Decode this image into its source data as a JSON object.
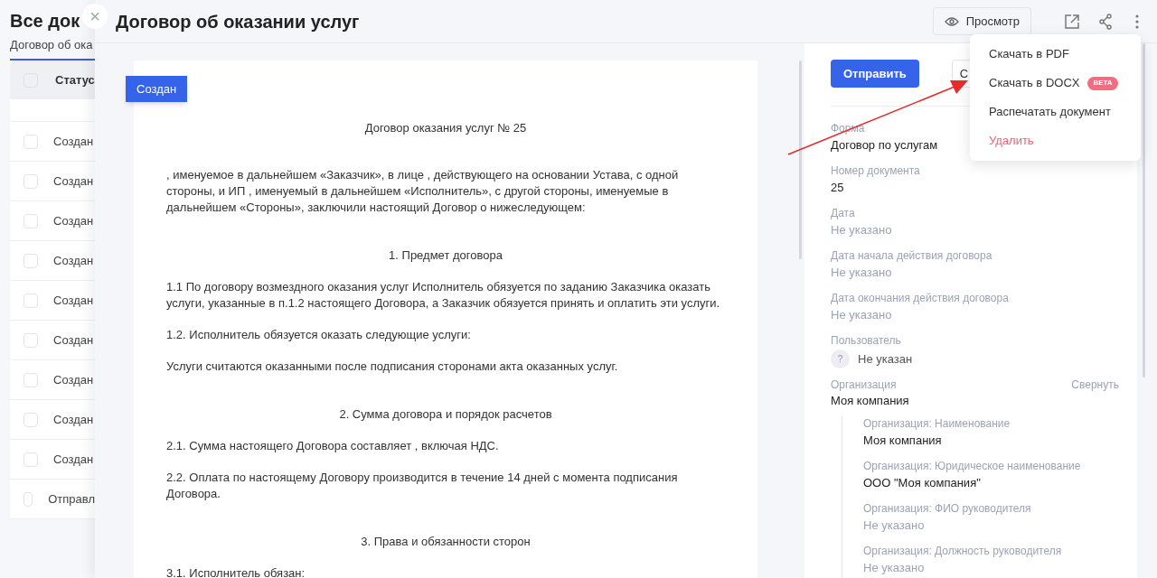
{
  "background_page": {
    "title": "Все док",
    "tab": "Договор об ока",
    "table": {
      "column": "Статус",
      "header_checked": false,
      "rows": [
        {
          "status": "Создан",
          "checked": false
        },
        {
          "status": "Создан",
          "checked": false
        },
        {
          "status": "Создан",
          "checked": false
        },
        {
          "status": "Создан",
          "checked": false
        },
        {
          "status": "Создан",
          "checked": false
        },
        {
          "status": "Создан",
          "checked": false
        },
        {
          "status": "Создан",
          "checked": false
        },
        {
          "status": "Создан",
          "checked": false
        },
        {
          "status": "Создан",
          "checked": false
        },
        {
          "status": "Отправл",
          "checked": false
        }
      ]
    }
  },
  "panel": {
    "close": "×",
    "title": "Договор об оказании услуг",
    "preview_button": "Просмотр",
    "document": {
      "ribbon": "Создан",
      "blocks": [
        {
          "kind": "title",
          "text": "Договор оказания услуг № 25"
        },
        {
          "kind": "paragraph",
          "text": ", именуемое в дальнейшем «Заказчик», в лице , действующего на основании Устава, с одной стороны, и ИП , именуемый в дальнейшем «Исполнитель», с другой стороны, именуемые в дальнейшем «Стороны», заключили настоящий Договор о нижеследующем:"
        },
        {
          "kind": "heading",
          "text": "1. Предмет договора"
        },
        {
          "kind": "paragraph",
          "text": "1.1 По договору возмездного оказания услуг Исполнитель обязуется по заданию Заказчика оказать услуги, указанные в п.1.2 настоящего Договора, а Заказчик обязуется принять и оплатить эти услуги."
        },
        {
          "kind": "paragraph",
          "text": "1.2. Исполнитель обязуется оказать следующие услуги:"
        },
        {
          "kind": "paragraph",
          "text": "Услуги считаются оказанными после подписания сторонами акта оказанных услуг."
        },
        {
          "kind": "heading",
          "text": "2. Сумма договора и порядок расчетов"
        },
        {
          "kind": "paragraph",
          "text": "2.1. Сумма настоящего Договора составляет , включая НДС."
        },
        {
          "kind": "paragraph",
          "text": "2.2. Оплата по настоящему Договору производится в течение 14 дней с момента подписания Договора."
        },
        {
          "kind": "heading",
          "text": "3. Права и обязанности сторон"
        },
        {
          "kind": "paragraph",
          "text": "3.1. Исполнитель обязан:"
        }
      ]
    },
    "sidebar": {
      "send_button": "Отправить",
      "second_button": "С",
      "fields": [
        {
          "label": "Форма",
          "value": "Договор по услугам",
          "empty": false
        },
        {
          "label": "Номер документа",
          "value": "25",
          "empty": false
        },
        {
          "label": "Дата",
          "value": "Не указано",
          "empty": true
        },
        {
          "label": "Дата начала действия договора",
          "value": "Не указано",
          "empty": true
        },
        {
          "label": "Дата окончания действия договора",
          "value": "Не указано",
          "empty": true
        }
      ],
      "user": {
        "label": "Пользователь",
        "avatar": "?",
        "value": "Не указан"
      },
      "organization": {
        "label": "Организация",
        "toggle": "Свернуть",
        "value": "Моя компания",
        "details": [
          {
            "label": "Организация: Наименование",
            "value": "Моя компания",
            "empty": false
          },
          {
            "label": "Организация: Юридическое наименование",
            "value": "ООО \"Моя компания\"",
            "empty": false
          },
          {
            "label": "Организация: ФИО руководителя",
            "value": "Не указано",
            "empty": true
          },
          {
            "label": "Организация: Должность руководителя",
            "value": "Не указано",
            "empty": true
          }
        ]
      }
    }
  },
  "menu": {
    "items": [
      {
        "label": "Скачать в PDF",
        "kind": "normal"
      },
      {
        "label": "Скачать в DOCX",
        "kind": "normal",
        "badge": "BETA"
      },
      {
        "label": "Распечатать документ",
        "kind": "normal"
      },
      {
        "label": "Удалить",
        "kind": "danger"
      }
    ]
  }
}
